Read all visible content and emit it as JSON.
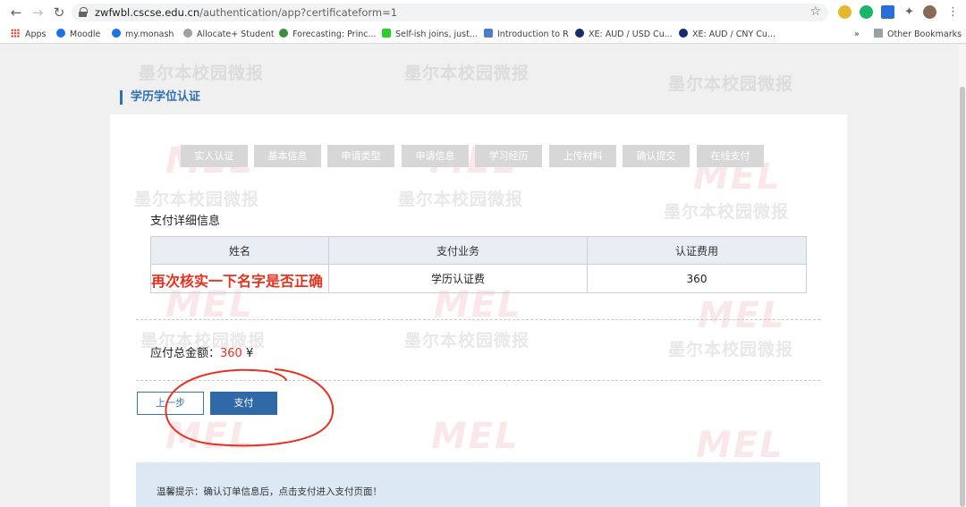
{
  "browser": {
    "url_host": "zwfwbl.cscse.edu.cn",
    "url_path": "/authentication/app?certificateform=1",
    "bookmarks": [
      {
        "label": "Apps",
        "color": "#e8453c"
      },
      {
        "label": "Moodle",
        "color": "#1a73e8"
      },
      {
        "label": "my.monash",
        "color": "#1a73e8"
      },
      {
        "label": "Allocate+ Student",
        "color": "#5f6368"
      },
      {
        "label": "Forecasting: Princ...",
        "color": "#3b8f3b"
      },
      {
        "label": "Self-ish joins, just...",
        "color": "#2ecc2e"
      },
      {
        "label": "Introduction to R",
        "color": "#4a7ec8"
      },
      {
        "label": "XE: AUD / USD Cu...",
        "color": "#1a2a6c"
      },
      {
        "label": "XE: AUD / CNY Cu...",
        "color": "#1a2a6c"
      }
    ],
    "more_bookmarks": "»",
    "other_bookmarks": "Other Bookmarks"
  },
  "page": {
    "section_title": "学历学位认证",
    "steps": [
      "实人认证",
      "基本信息",
      "申请类型",
      "申请信息",
      "学习经历",
      "上传材料",
      "确认提交",
      "在线支付"
    ],
    "detail_title": "支付详细信息",
    "table": {
      "headers": [
        "姓名",
        "支付业务",
        "认证费用"
      ],
      "rows": [
        {
          "name": "",
          "business": "学历认证费",
          "fee": "360"
        }
      ]
    },
    "annotation": "再次核实一下名字是否正确",
    "total_label": "应付总金额：",
    "total_amount": "360",
    "currency": "¥",
    "prev_button": "上一步",
    "pay_button": "支付",
    "tip": "温馨提示：确认订单信息后，点击支付进入支付页面！",
    "watermark_text": "墨尔本校园微报",
    "watermark_logo": "MEL"
  }
}
